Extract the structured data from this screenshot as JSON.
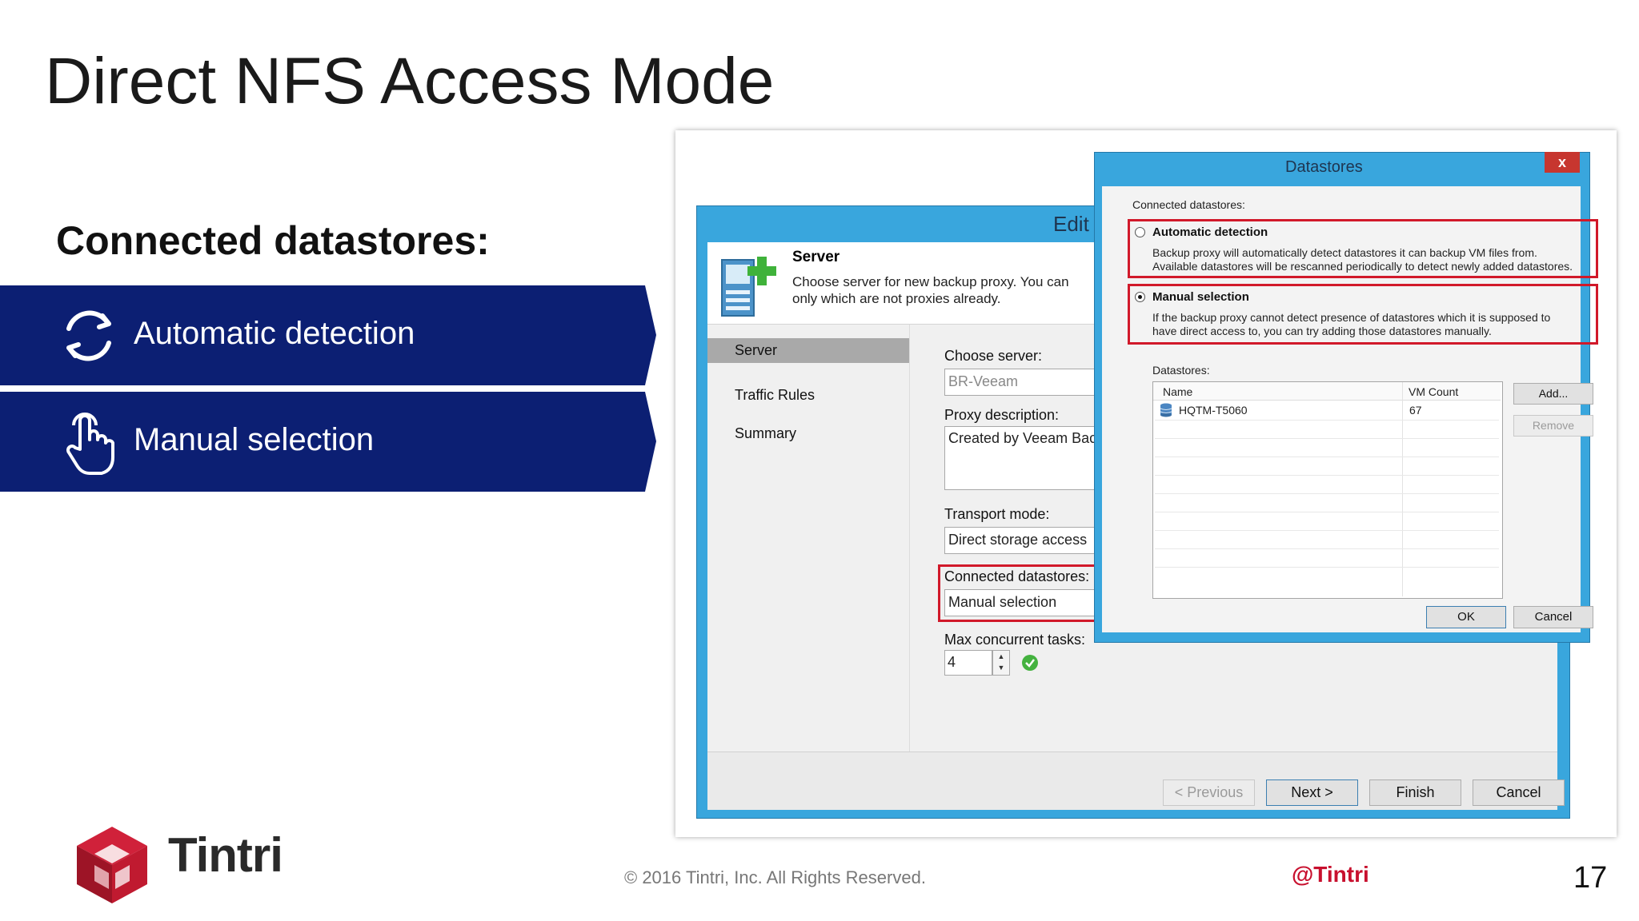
{
  "slide": {
    "title": "Direct NFS Access Mode",
    "heading": "Connected datastores:",
    "options": [
      {
        "label": "Automatic detection",
        "icon": "refresh-icon"
      },
      {
        "label": "Manual selection",
        "icon": "hand-pointer-icon"
      }
    ],
    "copyright": "© 2016 Tintri, Inc. All Rights Reserved.",
    "handle": "@Tintri",
    "page_number": "17",
    "logo_text": "Tintri"
  },
  "edit_dialog": {
    "title": "Edit V",
    "header_title": "Server",
    "header_desc": "Choose server for new backup proxy. You can only which are not proxies already.",
    "nav": [
      "Server",
      "Traffic Rules",
      "Summary"
    ],
    "choose_server_label": "Choose server:",
    "choose_server_value": "BR-Veeam",
    "proxy_desc_label": "Proxy description:",
    "proxy_desc_value": "Created by Veeam Backup",
    "transport_label": "Transport mode:",
    "transport_value": "Direct storage access",
    "connected_label": "Connected datastores:",
    "connected_value": "Manual selection",
    "max_tasks_label": "Max concurrent tasks:",
    "max_tasks_value": "4",
    "buttons": {
      "previous": "< Previous",
      "next": "Next >",
      "finish": "Finish",
      "cancel": "Cancel"
    }
  },
  "datastores_dialog": {
    "title": "Datastores",
    "close": "x",
    "connected_label": "Connected datastores:",
    "auto_title": "Automatic detection",
    "auto_desc1": "Backup proxy will automatically detect datastores it can backup VM files from.",
    "auto_desc2": "Available datastores will be rescanned periodically to detect newly added datastores.",
    "manual_title": "Manual selection",
    "manual_desc1": "If the backup proxy cannot detect presence of datastores which it is supposed to",
    "manual_desc2": "have direct access to, you can try adding those datastores manually.",
    "datastores_label": "Datastores:",
    "columns": [
      "Name",
      "VM Count"
    ],
    "rows": [
      {
        "name": "HQTM-T5060",
        "count": "67"
      }
    ],
    "buttons": {
      "add": "Add...",
      "remove": "Remove",
      "ok": "OK",
      "cancel": "Cancel"
    }
  },
  "colors": {
    "banner": "#0c1f73",
    "dialog_frame": "#39a6dd",
    "highlight": "#d1192a",
    "brand": "#c8102e"
  }
}
